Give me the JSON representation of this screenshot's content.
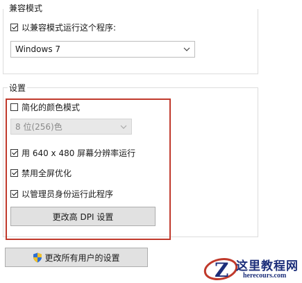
{
  "compat": {
    "group_title": "兼容模式",
    "run_compat_label": "以兼容模式运行这个程序:",
    "run_compat_checked": true,
    "os_value": "Windows 7"
  },
  "settings": {
    "group_title": "设置",
    "reduced_color_label": "简化的颜色模式",
    "reduced_color_checked": false,
    "color_value": "8 位(256)色",
    "res640_label": "用 640 x 480 屏幕分辨率运行",
    "res640_checked": true,
    "disable_fullscreen_label": "禁用全屏优化",
    "disable_fullscreen_checked": true,
    "run_admin_label": "以管理员身份运行此程序",
    "run_admin_checked": true,
    "dpi_button": "更改高 DPI 设置"
  },
  "all_users_button": "更改所有用户的设置",
  "watermark": {
    "cn": "这里教程网",
    "en": "herecours.com"
  },
  "colors": {
    "highlight": "#c0392b",
    "logo": "#1c2e7a"
  }
}
